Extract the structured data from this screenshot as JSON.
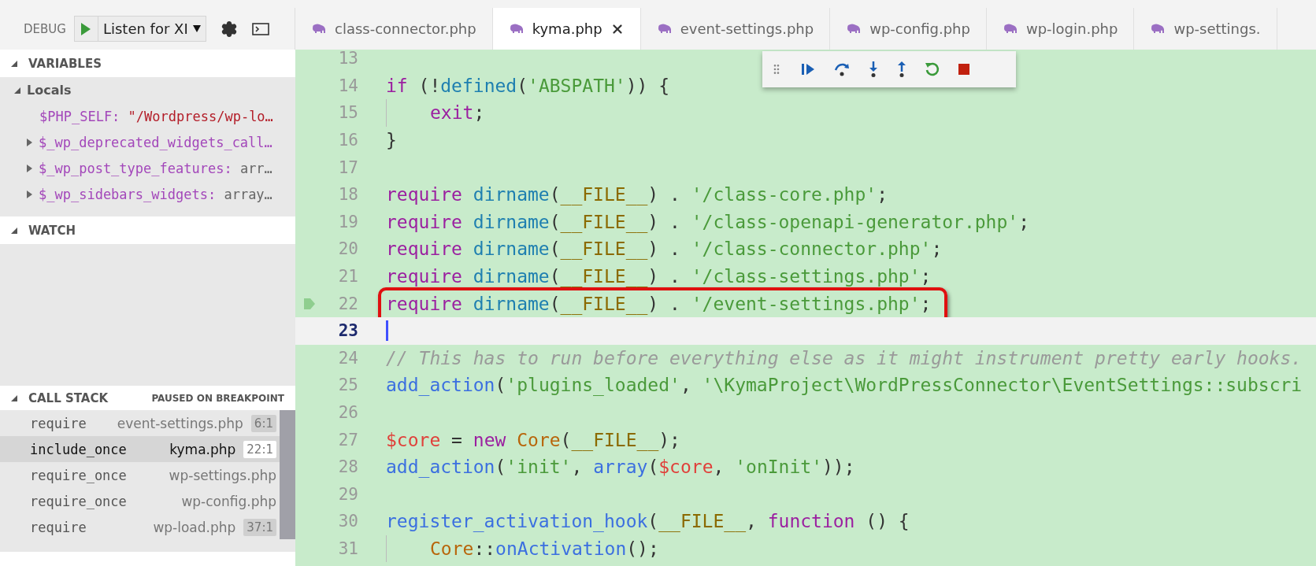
{
  "debug_bar": {
    "label": "DEBUG",
    "configuration": "Listen for XI"
  },
  "sidebar": {
    "variables": {
      "title": "VARIABLES",
      "expanded": true,
      "scopes": [
        {
          "name": "Locals",
          "expanded": true,
          "items": [
            {
              "name": "$PHP_SELF:",
              "value": "\"/Wordpress/wp-lo…",
              "kind": "string",
              "expandable": false
            },
            {
              "name": "$_wp_deprecated_widgets_call…",
              "expandable": true
            },
            {
              "name": "$_wp_post_type_features:",
              "value": "arr…",
              "kind": "other",
              "expandable": true
            },
            {
              "name": "$_wp_sidebars_widgets:",
              "value": "array…",
              "kind": "other",
              "expandable": true
            }
          ]
        }
      ]
    },
    "watch": {
      "title": "WATCH",
      "expanded": true
    },
    "call_stack": {
      "title": "CALL STACK",
      "status": "PAUSED ON BREAKPOINT",
      "expanded": true,
      "frames": [
        {
          "function": "require",
          "file": "event-settings.php",
          "position": "6:1",
          "selected": false
        },
        {
          "function": "include_once",
          "file": "kyma.php",
          "position": "22:1",
          "selected": true
        },
        {
          "function": "require_once",
          "file": "wp-settings.php",
          "selected": false
        },
        {
          "function": "require_once",
          "file": "wp-config.php",
          "selected": false
        },
        {
          "function": "require",
          "file": "wp-load.php",
          "position": "37:1",
          "selected": false
        }
      ]
    }
  },
  "tabs": [
    {
      "label": "class-connector.php",
      "selected": false
    },
    {
      "label": "kyma.php",
      "selected": true
    },
    {
      "label": "event-settings.php",
      "selected": false
    },
    {
      "label": "wp-config.php",
      "selected": false
    },
    {
      "label": "wp-login.php",
      "selected": false
    },
    {
      "label": "wp-settings.",
      "selected": false
    }
  ],
  "editor": {
    "lines": [
      {
        "n": "13",
        "stack_frame": false,
        "current": false,
        "annotated": false,
        "indented": false
      },
      {
        "n": "14",
        "stack_frame": false,
        "current": false,
        "annotated": false,
        "indented": false,
        "tokens": [
          {
            "kind": "kw",
            "text": "if"
          },
          {
            "kind": "plain",
            "text": " (!"
          },
          {
            "kind": "fn",
            "text": "defined"
          },
          {
            "kind": "plain",
            "text": "("
          },
          {
            "kind": "str",
            "text": "'ABSPATH'"
          },
          {
            "kind": "plain",
            "text": ")) {"
          }
        ]
      },
      {
        "n": "15",
        "stack_frame": false,
        "current": false,
        "annotated": false,
        "indented": true,
        "tokens": [
          {
            "kind": "kw",
            "text": "exit"
          },
          {
            "kind": "plain",
            "text": ";"
          }
        ]
      },
      {
        "n": "16",
        "stack_frame": false,
        "current": false,
        "annotated": false,
        "indented": false,
        "tokens": [
          {
            "kind": "plain",
            "text": "}"
          }
        ]
      },
      {
        "n": "17",
        "stack_frame": false,
        "current": false,
        "annotated": false,
        "indented": false
      },
      {
        "n": "18",
        "stack_frame": false,
        "current": false,
        "annotated": false,
        "indented": false,
        "tokens": [
          {
            "kind": "kw",
            "text": "require"
          },
          {
            "kind": "fn",
            "text": " dirname"
          },
          {
            "kind": "plain",
            "text": "("
          },
          {
            "kind": "const",
            "text": "__FILE__"
          },
          {
            "kind": "plain",
            "text": ") . "
          },
          {
            "kind": "str",
            "text": "'/class-core.php'"
          },
          {
            "kind": "plain",
            "text": ";"
          }
        ]
      },
      {
        "n": "19",
        "stack_frame": false,
        "current": false,
        "annotated": false,
        "indented": false,
        "tokens": [
          {
            "kind": "kw",
            "text": "require"
          },
          {
            "kind": "fn",
            "text": " dirname"
          },
          {
            "kind": "plain",
            "text": "("
          },
          {
            "kind": "const",
            "text": "__FILE__"
          },
          {
            "kind": "plain",
            "text": ") . "
          },
          {
            "kind": "str",
            "text": "'/class-openapi-generator.php'"
          },
          {
            "kind": "plain",
            "text": ";"
          }
        ]
      },
      {
        "n": "20",
        "stack_frame": false,
        "current": false,
        "annotated": false,
        "indented": false,
        "tokens": [
          {
            "kind": "kw",
            "text": "require"
          },
          {
            "kind": "fn",
            "text": " dirname"
          },
          {
            "kind": "plain",
            "text": "("
          },
          {
            "kind": "const",
            "text": "__FILE__"
          },
          {
            "kind": "plain",
            "text": ") . "
          },
          {
            "kind": "str",
            "text": "'/class-connector.php'"
          },
          {
            "kind": "plain",
            "text": ";"
          }
        ]
      },
      {
        "n": "21",
        "stack_frame": false,
        "current": false,
        "annotated": false,
        "indented": false,
        "tokens": [
          {
            "kind": "kw",
            "text": "require"
          },
          {
            "kind": "fn",
            "text": " dirname"
          },
          {
            "kind": "plain",
            "text": "("
          },
          {
            "kind": "const",
            "text": "__FILE__"
          },
          {
            "kind": "plain",
            "text": ") . "
          },
          {
            "kind": "str",
            "text": "'/class-settings.php'"
          },
          {
            "kind": "plain",
            "text": ";"
          }
        ]
      },
      {
        "n": "22",
        "stack_frame": true,
        "current": false,
        "annotated": true,
        "indented": false,
        "tokens": [
          {
            "kind": "kw",
            "text": "require"
          },
          {
            "kind": "fn",
            "text": " dirname"
          },
          {
            "kind": "plain",
            "text": "("
          },
          {
            "kind": "const",
            "text": "__FILE__"
          },
          {
            "kind": "plain",
            "text": ") . "
          },
          {
            "kind": "str",
            "text": "'/event-settings.php'"
          },
          {
            "kind": "plain",
            "text": ";"
          }
        ]
      },
      {
        "n": "23",
        "stack_frame": false,
        "current": true,
        "annotated": false,
        "indented": false
      },
      {
        "n": "24",
        "stack_frame": false,
        "current": false,
        "annotated": false,
        "indented": false,
        "tokens": [
          {
            "kind": "comment",
            "text": "// This has to run before everything else as it might instrument pretty early hooks."
          }
        ]
      },
      {
        "n": "25",
        "stack_frame": false,
        "current": false,
        "annotated": false,
        "indented": false,
        "tokens": [
          {
            "kind": "call",
            "text": "add_action"
          },
          {
            "kind": "plain",
            "text": "("
          },
          {
            "kind": "str",
            "text": "'plugins_loaded'"
          },
          {
            "kind": "plain",
            "text": ", "
          },
          {
            "kind": "str",
            "text": "'\\KymaProject\\WordPressConnector\\EventSettings::subscri"
          }
        ]
      },
      {
        "n": "26",
        "stack_frame": false,
        "current": false,
        "annotated": false,
        "indented": false
      },
      {
        "n": "27",
        "stack_frame": false,
        "current": false,
        "annotated": false,
        "indented": false,
        "tokens": [
          {
            "kind": "var",
            "text": "$core"
          },
          {
            "kind": "plain",
            "text": " = "
          },
          {
            "kind": "kw",
            "text": "new"
          },
          {
            "kind": "cls",
            "text": " Core"
          },
          {
            "kind": "plain",
            "text": "("
          },
          {
            "kind": "const",
            "text": "__FILE__"
          },
          {
            "kind": "plain",
            "text": ");"
          }
        ]
      },
      {
        "n": "28",
        "stack_frame": false,
        "current": false,
        "annotated": false,
        "indented": false,
        "tokens": [
          {
            "kind": "call",
            "text": "add_action"
          },
          {
            "kind": "plain",
            "text": "("
          },
          {
            "kind": "str",
            "text": "'init'"
          },
          {
            "kind": "plain",
            "text": ", "
          },
          {
            "kind": "call",
            "text": "array"
          },
          {
            "kind": "plain",
            "text": "("
          },
          {
            "kind": "var",
            "text": "$core"
          },
          {
            "kind": "plain",
            "text": ", "
          },
          {
            "kind": "str",
            "text": "'onInit'"
          },
          {
            "kind": "plain",
            "text": "));"
          }
        ]
      },
      {
        "n": "29",
        "stack_frame": false,
        "current": false,
        "annotated": false,
        "indented": false
      },
      {
        "n": "30",
        "stack_frame": false,
        "current": false,
        "annotated": false,
        "indented": false,
        "tokens": [
          {
            "kind": "call",
            "text": "register_activation_hook"
          },
          {
            "kind": "plain",
            "text": "("
          },
          {
            "kind": "const",
            "text": "__FILE__"
          },
          {
            "kind": "plain",
            "text": ", "
          },
          {
            "kind": "kw",
            "text": "function"
          },
          {
            "kind": "plain",
            "text": " () {"
          }
        ]
      },
      {
        "n": "31",
        "stack_frame": false,
        "current": false,
        "annotated": false,
        "indented": true,
        "tokens": [
          {
            "kind": "cls",
            "text": "Core"
          },
          {
            "kind": "plain",
            "text": "::"
          },
          {
            "kind": "call",
            "text": "onActivation"
          },
          {
            "kind": "plain",
            "text": "();"
          }
        ]
      }
    ]
  },
  "debug_controls": [
    {
      "kind": "continue"
    },
    {
      "kind": "step_over"
    },
    {
      "kind": "step_into"
    },
    {
      "kind": "step_out"
    },
    {
      "kind": "restart"
    },
    {
      "kind": "stop"
    }
  ]
}
